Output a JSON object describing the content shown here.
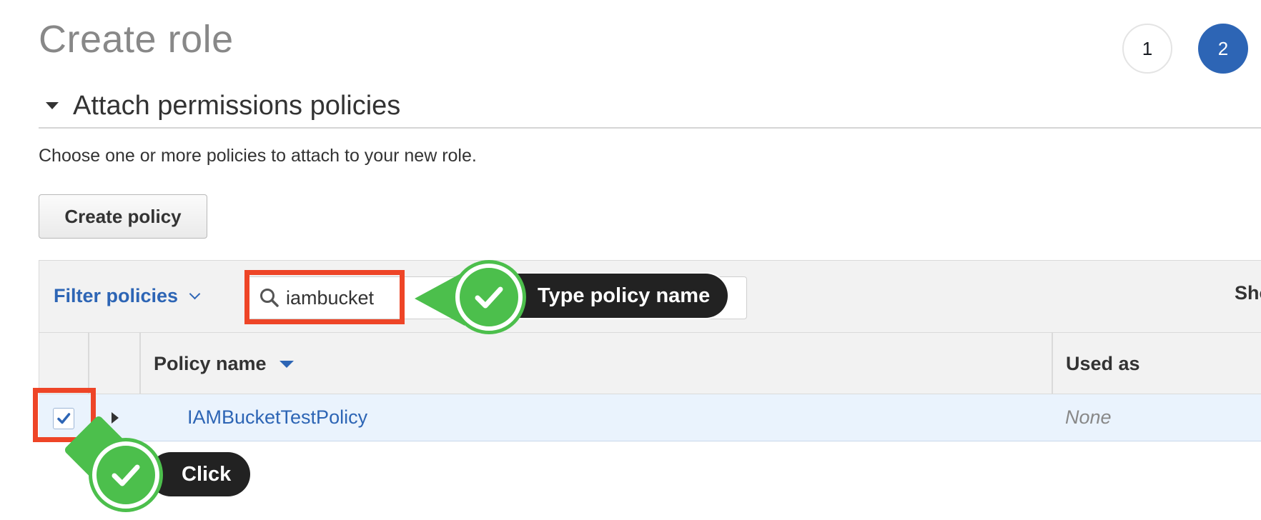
{
  "page": {
    "title": "Create role"
  },
  "steps": [
    "1",
    "2"
  ],
  "section": {
    "title": "Attach permissions policies",
    "description": "Choose one or more policies to attach to your new role."
  },
  "buttons": {
    "create_policy": "Create policy"
  },
  "filter": {
    "label": "Filter policies",
    "search_value": "iambucket",
    "show_text": "Sho"
  },
  "table": {
    "columns": [
      "Policy name",
      "Used as"
    ],
    "rows": [
      {
        "name": "IAMBucketTestPolicy",
        "used_as": "None",
        "checked": true
      }
    ]
  },
  "annotations": {
    "search_hint": "Type policy name",
    "checkbox_hint": "Click"
  },
  "colors": {
    "accent": "#2d65b5",
    "highlight": "#ee4527",
    "callout_green": "#4cbf4c",
    "row_selected": "#eaf3fd"
  }
}
